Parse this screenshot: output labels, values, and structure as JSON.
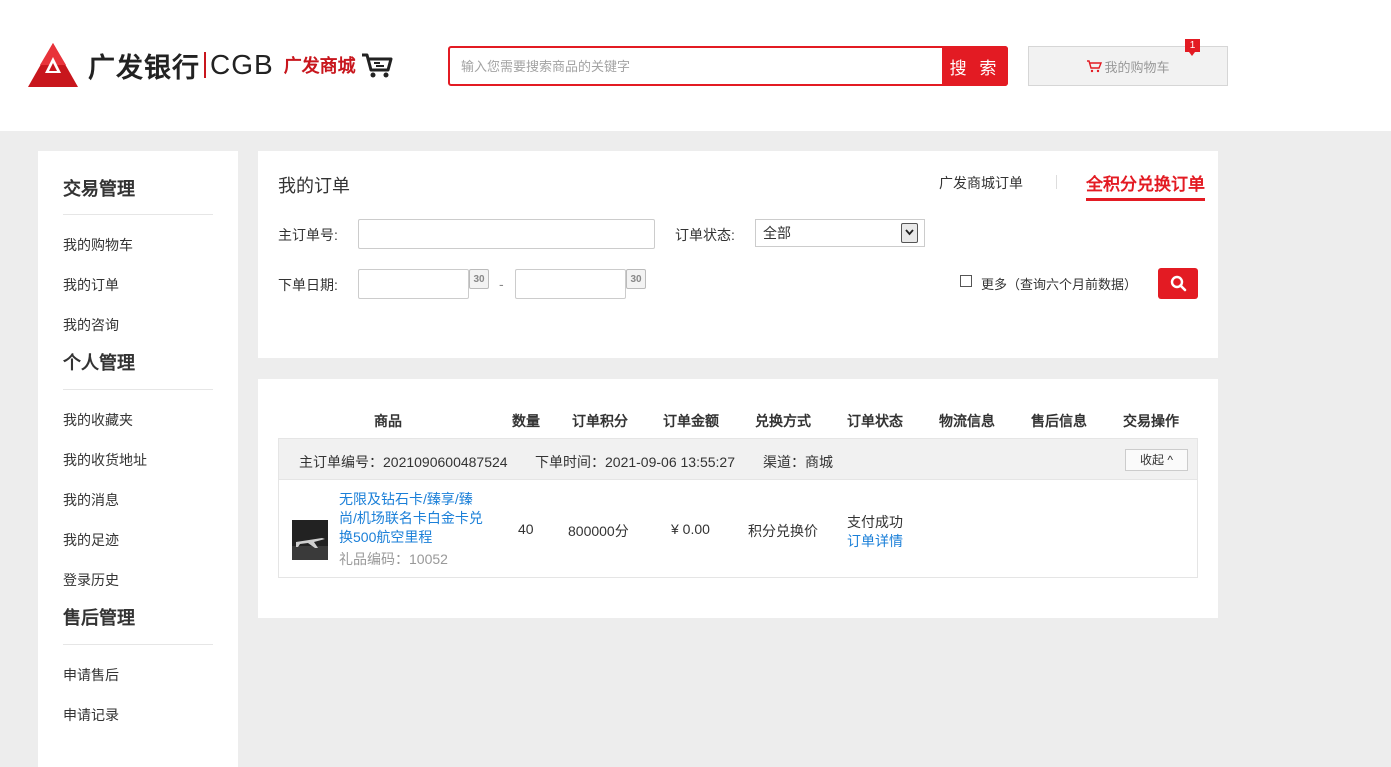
{
  "header": {
    "logo_bank": "广发银行",
    "logo_cgb": "CGB",
    "logo_mall": "广发商城",
    "search_placeholder": "输入您需要搜索商品的关键字",
    "search_button": "搜 索",
    "cart_label": "我的购物车",
    "cart_count": "1"
  },
  "sidebar": {
    "groups": [
      {
        "title": "交易管理",
        "items": [
          "我的购物车",
          "我的订单",
          "我的咨询"
        ]
      },
      {
        "title": "个人管理",
        "items": [
          "我的收藏夹",
          "我的收货地址",
          "我的消息",
          "我的足迹",
          "登录历史"
        ]
      },
      {
        "title": "售后管理",
        "items": [
          "申请售后",
          "申请记录"
        ]
      }
    ]
  },
  "filter": {
    "title": "我的订单",
    "tab_mall": "广发商城订单",
    "tab_points": "全积分兑换订单",
    "order_no_label": "主订单号:",
    "status_label": "订单状态:",
    "status_value": "全部",
    "date_label": "下单日期:",
    "calendar_text": "30",
    "date_dash": "-",
    "more_label": "更多（查询六个月前数据）"
  },
  "orders": {
    "columns": [
      "商品",
      "数量",
      "订单积分",
      "订单金额",
      "兑换方式",
      "订单状态",
      "物流信息",
      "售后信息",
      "交易操作"
    ],
    "order_no": "主订单编号：2021090600487524",
    "order_time": "下单时间：2021-09-06 13:55:27",
    "channel": "渠道：商城",
    "collapse_label": "收起 ^",
    "item": {
      "name": "无限及钻石卡/臻享/臻尚/机场联名卡白金卡兑换500航空里程",
      "gift_code": "礼品编码：10052",
      "quantity": "40",
      "points": "800000分",
      "amount": "¥ 0.00",
      "method": "积分兑换价",
      "status": "支付成功",
      "detail_link": "订单详情"
    }
  },
  "colors": {
    "accent": "#e31b23",
    "link": "#1a7fd8"
  }
}
